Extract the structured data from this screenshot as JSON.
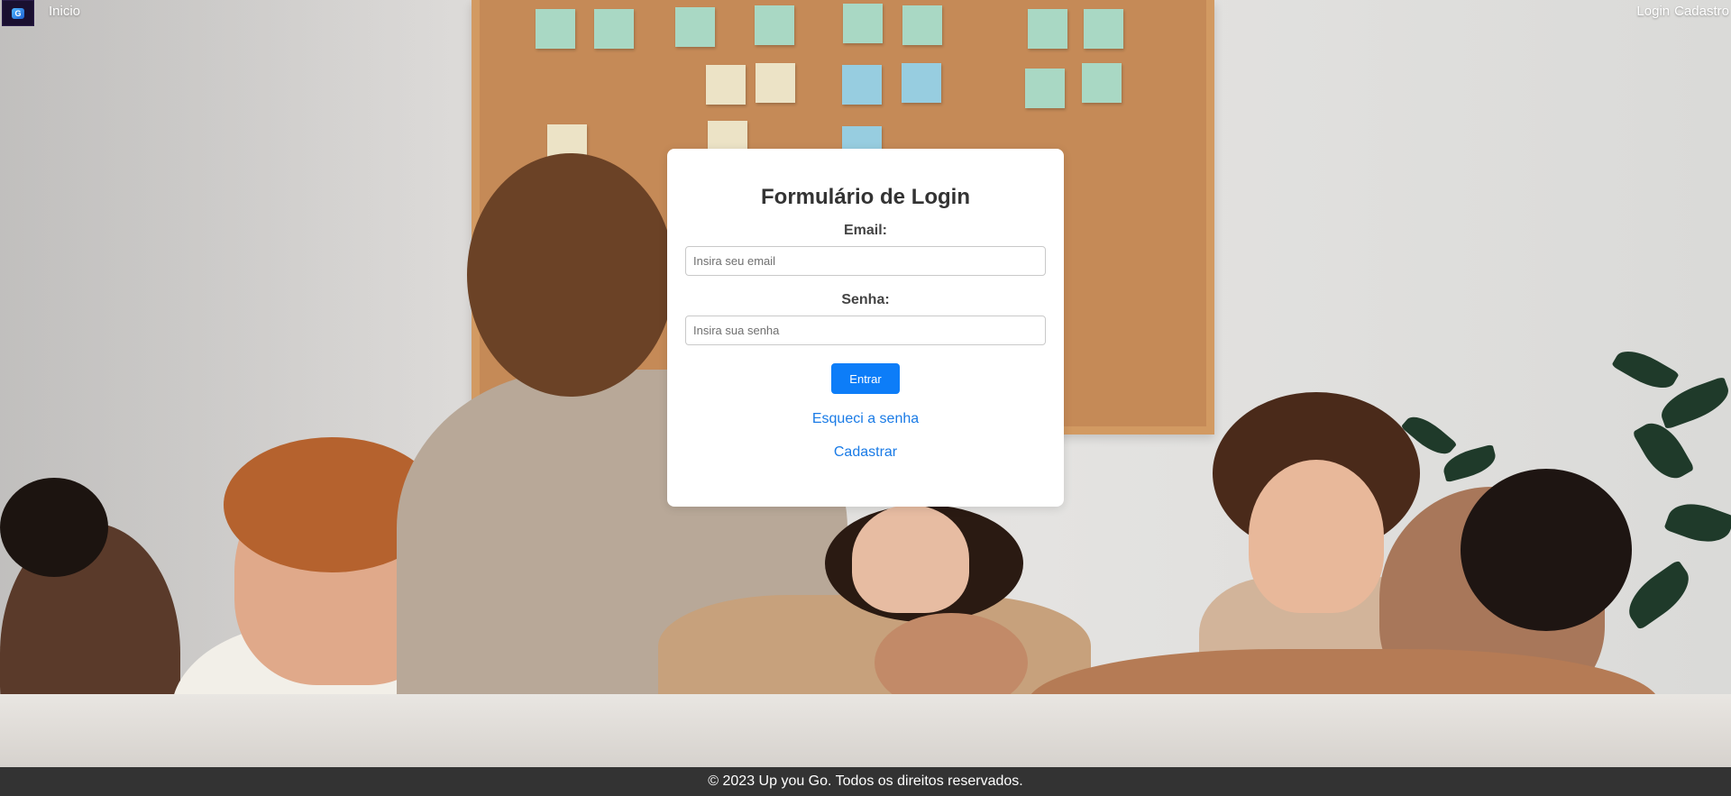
{
  "nav": {
    "logo_text": "G",
    "home_label": "Inicio",
    "login_label": "Login",
    "register_label": "Cadastro"
  },
  "login_form": {
    "title": "Formulário de Login",
    "email_label": "Email:",
    "email_placeholder": "Insira seu email",
    "email_value": "",
    "password_label": "Senha:",
    "password_placeholder": "Insira sua senha",
    "password_value": "",
    "submit_label": "Entrar",
    "forgot_label": "Esqueci a senha",
    "register_label": "Cadastrar"
  },
  "footer": {
    "copyright": "© 2023 Up you Go. Todos os direitos reservados."
  },
  "colors": {
    "primary_button": "#0d7df8",
    "link": "#1a7be6",
    "footer_bg": "#333333"
  }
}
